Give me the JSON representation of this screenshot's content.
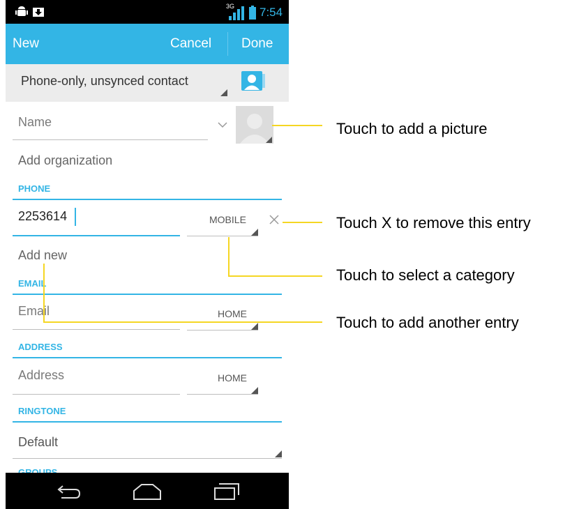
{
  "status_bar": {
    "network": "3G",
    "time": "7:54"
  },
  "action_bar": {
    "new_label": "New",
    "cancel_label": "Cancel",
    "done_label": "Done"
  },
  "account": {
    "label": "Phone-only, unsynced contact"
  },
  "name_field": {
    "placeholder": "Name"
  },
  "organization": {
    "label": "Add organization"
  },
  "phone_section": {
    "header": "PHONE",
    "value": "2253614",
    "category": "MOBILE",
    "add_new": "Add new"
  },
  "email_section": {
    "header": "EMAIL",
    "placeholder": "Email",
    "category": "HOME"
  },
  "address_section": {
    "header": "ADDRESS",
    "placeholder": "Address",
    "category": "HOME"
  },
  "ringtone_section": {
    "header": "RINGTONE",
    "value": "Default"
  },
  "groups_section": {
    "header": "GROUPS"
  },
  "callouts": {
    "picture": "Touch to add a picture",
    "remove": "Touch X to remove this entry",
    "category": "Touch to select a category",
    "add_entry": "Touch to add another entry"
  },
  "colors": {
    "accent": "#33b5e5",
    "callout_line": "#f5d623",
    "status_bar": "#000000"
  },
  "icons": [
    "android-debug-icon",
    "download-icon",
    "signal-icon",
    "battery-icon",
    "contact-card-icon",
    "expand-chevron-icon",
    "avatar-placeholder-icon",
    "remove-x-icon",
    "back-icon",
    "home-icon",
    "recents-icon"
  ]
}
